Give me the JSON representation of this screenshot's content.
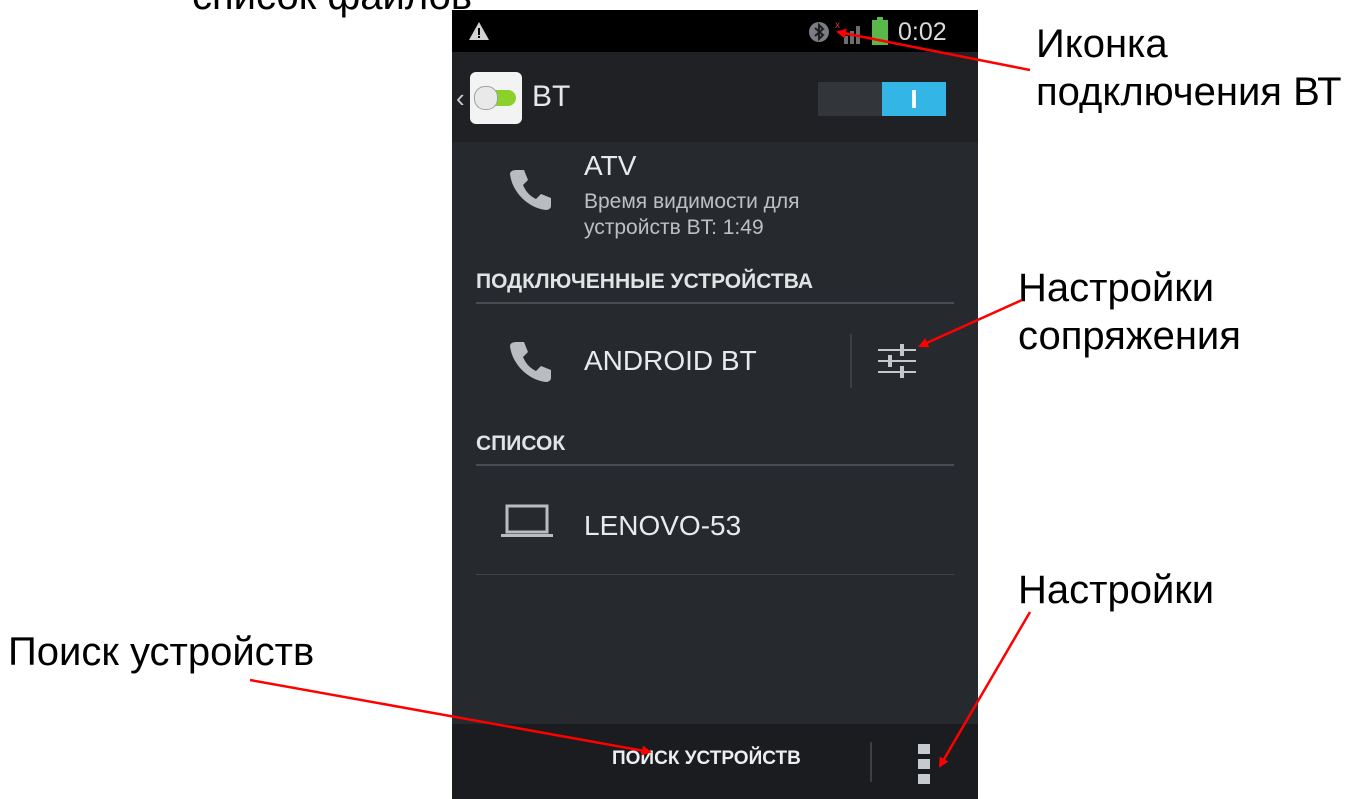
{
  "annotations": {
    "top_cut_text": "список файлов",
    "bt_icon_label_line1": "Иконка",
    "bt_icon_label_line2": "подключения ВТ",
    "pairing_label_line1": "Настройки",
    "pairing_label_line2": "сопряжения",
    "settings_label": "Настройки",
    "search_label": "Поиск устройств",
    "arrow_color": "#ff0000"
  },
  "statusbar": {
    "time": "0:02",
    "icons": [
      "warning-icon",
      "bluetooth-icon",
      "signal-icon",
      "battery-icon"
    ]
  },
  "actionbar": {
    "title": "BT",
    "switch_state": "I",
    "accent": "#33b5e5"
  },
  "device_self": {
    "name": "ATV",
    "visibility_line1": "Время видимости для",
    "visibility_line2": "устройств BT: 1:49",
    "icon": "phone-icon"
  },
  "connected_section": {
    "header": "ПОДКЛЮЧЕННЫЕ УСТРОЙСТВА",
    "devices": [
      {
        "name": "ANDROID BT",
        "icon": "phone-icon",
        "action_icon": "settings-sliders-icon"
      }
    ]
  },
  "list_section": {
    "header": "СПИСОК",
    "devices": [
      {
        "name": "LENOVO-53",
        "icon": "laptop-icon"
      }
    ]
  },
  "bottombar": {
    "search_button": "ПОИСК УСТРОЙСТВ",
    "overflow_icon": "overflow-menu-icon"
  }
}
